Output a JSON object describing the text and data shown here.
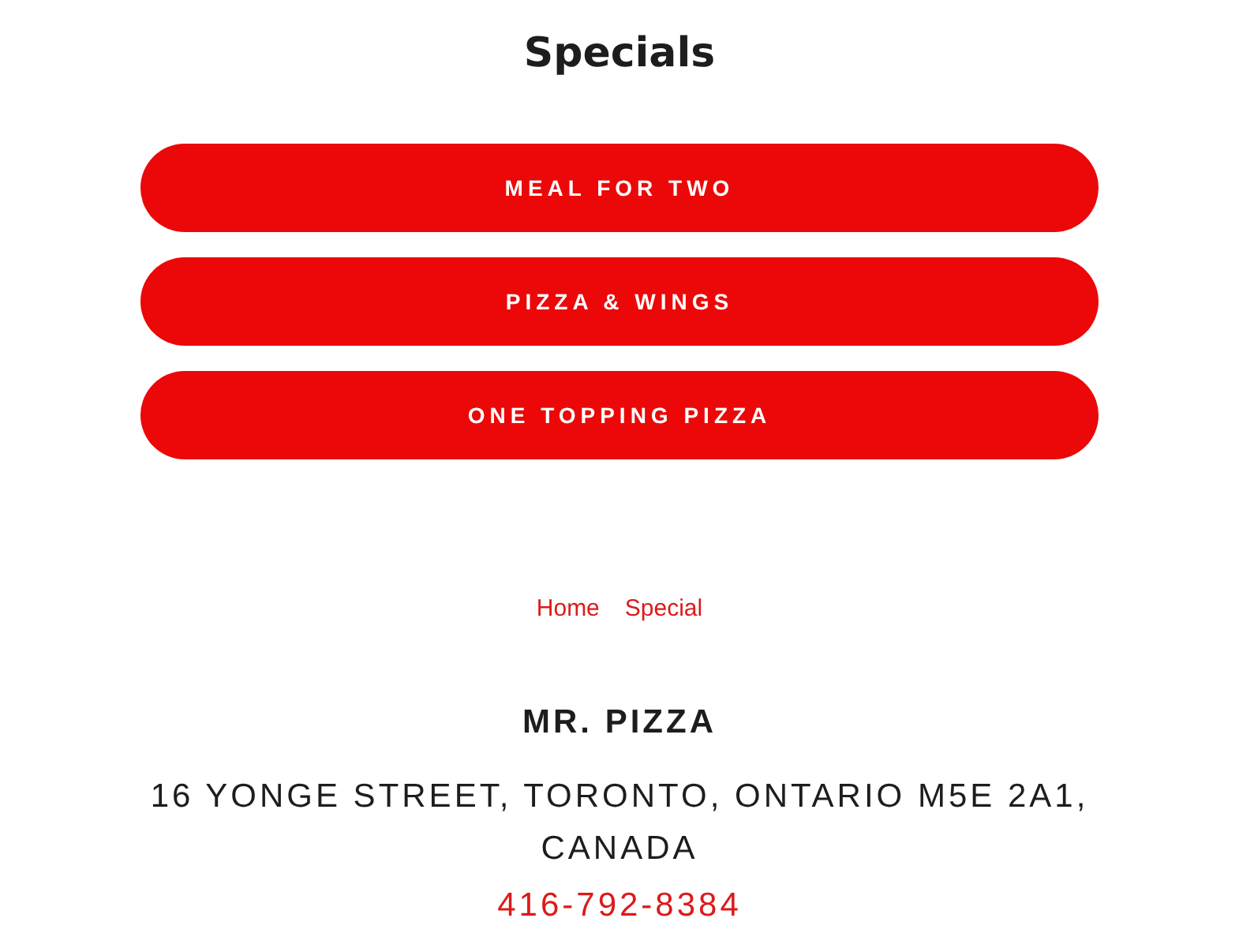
{
  "title": "Specials",
  "specials": [
    {
      "label": "MEAL FOR TWO"
    },
    {
      "label": "PIZZA & WINGS"
    },
    {
      "label": "ONE TOPPING PIZZA"
    }
  ],
  "breadcrumbs": [
    {
      "label": "Home"
    },
    {
      "label": "Special"
    }
  ],
  "footer": {
    "name": "MR. PIZZA",
    "address": "16 YONGE STREET, TORONTO, ONTARIO M5E 2A1, CANADA",
    "phone": "416-792-8384"
  }
}
